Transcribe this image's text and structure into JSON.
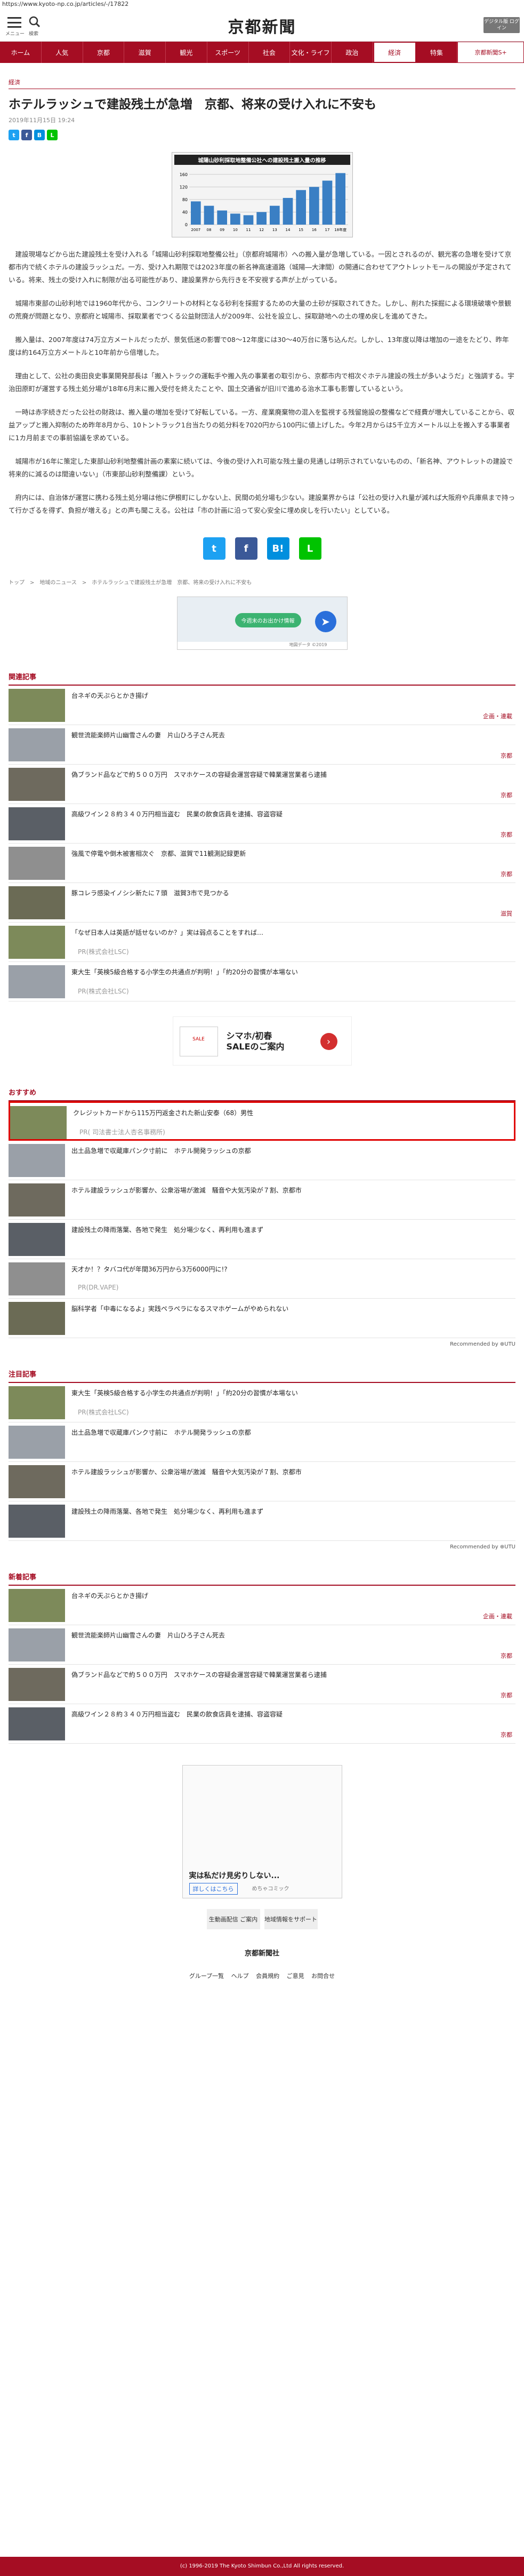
{
  "url": "https://www.kyoto-np.co.jp/articles/-/17822",
  "header": {
    "menu_label": "メニュー",
    "search_label": "検索",
    "logo": "京都新聞",
    "digital_label": "デジタル版\nログイン"
  },
  "nav": [
    "ホーム",
    "人気",
    "京都",
    "滋賀",
    "観光",
    "スポーツ",
    "社会",
    "文化・ライフ",
    "政治",
    "経済",
    "特集",
    "京都新聞S+"
  ],
  "section_label": "経済",
  "article": {
    "title": "ホテルラッシュで建設残土が急増　京都、将来の受け入れに不安も",
    "date": "2019年11月15日 19:24",
    "paragraphs": [
      "建設現場などから出た建設残土を受け入れる「城陽山砂利採取地整備公社」（京都府城陽市）への搬入量が急増している。一因とされるのが、観光客の急増を受けて京都市内で続くホテルの建設ラッシュだ。一方、受け入れ期限では2023年度の新名神高速道路（城陽―大津間）の開通に合わせてアウトレットモールの開設が予定されている。将来、残土の受け入れに制限が出る可能性があり、建設業界から先行きを不安視する声が上がっている。",
      "城陽市東部の山砂利地では1960年代から、コンクリートの材料となる砂利を採掘するための大量の土砂が採取されてきた。しかし、削れた採掘による環境破壊や景観の荒廃が問題となり、京都府と城陽市、採取業者でつくる公益財団法人が2009年、公社を設立し、採取跡地への土の埋め戻しを進めてきた。",
      "搬入量は、2007年度は74万立方メートルだったが、景気低迷の影響で08～12年度には30～40万台に落ち込んだ。しかし、13年度以降は増加の一途をたどり、昨年度は約164万立方メートルと10年前から倍増した。",
      "理由として、公社の奥田良史事業開発部長は「搬入トラックの運転手や搬入先の事業者の取引から、京都市内で相次ぐホテル建設の残土が多いようだ」と強調する。宇治田原町が運営する残土処分場が18年6月末に搬入受付を終えたことや、国土交通省が旧川で進める治水工事も影響しているという。",
      "一時は赤字続きだった公社の財政は、搬入量の増加を受けて好転している。一方、産業廃棄物の混入を監視する残留施設の整備などで経費が増大していることから、収益アップと搬入抑制のため昨年8月から、10トントラック1台当たりの処分料を7020円から100円に値上げした。今年2月からは5千立方メートル以上を搬入する事業者に1カ月前までの事前協議を求めている。",
      "城陽市が16年に策定した東部山砂利地整備計画の素案に続いては、今後の受け入れ可能な残土量の見通しは明示されていないものの、「新名神、アウトレットの建設で将来的に減るのは間違いない」（市東部山砂利整備課）という。",
      "府内には、自治体が運営に携わる残土処分場は他に伊根町にしかない上、民間の処分場も少ない。建設業界からは「公社の受け入れ量が減れば大阪府や兵庫県まで持って行かざるを得ず、負担が増える」との声も聞こえる。公社は「市の計画に沿って安心安全に埋め戻しを行いたい」としている。"
    ],
    "figure": {
      "title": "城陽山砂利採取地整備公社への建設残土搬入量の推移",
      "years": [
        "2007",
        "08",
        "09",
        "10",
        "11",
        "12",
        "13",
        "14",
        "15",
        "16",
        "17",
        "18年度"
      ],
      "values": [
        74,
        60,
        45,
        35,
        30,
        40,
        60,
        85,
        110,
        120,
        140,
        164
      ]
    }
  },
  "share": [
    "t",
    "f",
    "B!",
    "L"
  ],
  "breadcrumb": "トップ　>　地域のニュース　>　ホテルラッシュで建設残土が急増　京都、将来の受け入れに不安も",
  "map_ad": {
    "pill": "今週末のお出かけ情報",
    "foot": "地図データ ©2019"
  },
  "related": {
    "title": "関連記事",
    "items": [
      {
        "t": "台ネギの天ぷらとかき揚げ",
        "cat": "企画・連載"
      },
      {
        "t": "観世流能楽師片山幽雪さんの妻　片山ひろ子さん死去",
        "cat": "京都"
      },
      {
        "t": "偽ブランド品などで約５００万円　スマホケースの容疑会運営容疑で韓業運営業者ら逮捕",
        "cat": "京都"
      },
      {
        "t": "高級ワイン２８約３４０万円相当盗む　民業の飲食店員を逮捕、容盗容疑",
        "cat": "京都"
      },
      {
        "t": "強風で停電や倒木被害相次ぐ　京都、滋賀で11観測記録更新",
        "cat": "京都"
      },
      {
        "t": "豚コレラ感染イノシシ新たに７頭　滋賀3市で見つかる",
        "cat": "滋賀"
      },
      {
        "t": "「なぜ日本人は英語が話せないのか？」実は弱点ることをすれば…",
        "pr": "PR(株式会社LSC)"
      },
      {
        "t": "東大生「英検5級合格する小学生の共通点が判明！」「約20分の習慣が本場ない",
        "pr": "PR(株式会社LSC)"
      }
    ]
  },
  "ad_mid": {
    "box": "SALE",
    "text1": "シマホ/初春",
    "text2": "SALEのご案内"
  },
  "recommend": {
    "title": "おすすめ",
    "items": [
      {
        "t": "クレジットカードから115万円返金された新山安泰（68）男性",
        "pr": "PR( 司法書士法人杏名事務所)"
      },
      {
        "t": "出土品急増で収蔵庫パンク寸前に　ホテル開発ラッシュの京都"
      },
      {
        "t": "ホテル建設ラッシュが影響か、公衆浴場が激減　騒音や大気汚染が７割、京都市"
      },
      {
        "t": "建設残土の降雨落葉、各地で発生　処分場少なく、再利用も進まず"
      },
      {
        "t": "天才か！？タバコ代が年間36万円から3万6000円に!?",
        "pr": "PR(DR.VAPE)"
      },
      {
        "t": "脳科学者「中毒になるよ」実践ペラペラになるスマホゲームがやめられない"
      }
    ],
    "by": "Recommended by ⊕UTU"
  },
  "attention": {
    "title": "注目記事",
    "items": [
      {
        "t": "東大生「英検5級合格する小学生の共通点が判明！」「約20分の習慣が本場ない",
        "pr": "PR(株式会社LSC)"
      },
      {
        "t": "出土品急増で収蔵庫パンク寸前に　ホテル開発ラッシュの京都"
      },
      {
        "t": "ホテル建設ラッシュが影響か、公衆浴場が激減　騒音や大気汚染が７割、京都市"
      },
      {
        "t": "建設残土の降雨落葉、各地で発生　処分場少なく、再利用も進まず"
      }
    ],
    "by": "Recommended by ⊕UTU"
  },
  "latest": {
    "title": "新着記事",
    "items": [
      {
        "t": "台ネギの天ぷらとかき揚げ",
        "cat": "企画・連載"
      },
      {
        "t": "観世流能楽師片山幽雪さんの妻　片山ひろ子さん死去",
        "cat": "京都"
      },
      {
        "t": "偽ブランド品などで約５００万円　スマホケースの容疑会運営容疑で韓業運営業者ら逮捕",
        "cat": "京都"
      },
      {
        "t": "高級ワイン２８約３４０万円相当盗む　民業の飲食店員を逮捕、容盗容疑",
        "cat": "京都"
      }
    ]
  },
  "big_ad": {
    "text": "実は私だけ見劣りしない...",
    "btn": "詳しくはこちら",
    "brand": "めちゃコミック"
  },
  "footer": {
    "btn1": "生動画配信 ご案内",
    "btn2": "地域情報をサポート",
    "logo": "京都新聞社",
    "links": "グループ一覧 ヘルプ 会員規約 ご意見 お問合せ",
    "copyright": "(c) 1996-2019 The Kyoto Shimbun Co.,Ltd All rights reserved."
  }
}
